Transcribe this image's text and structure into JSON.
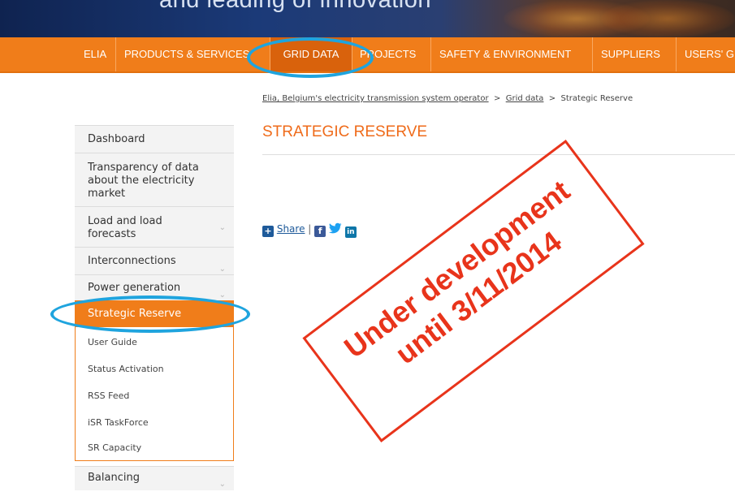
{
  "header": {
    "tagline": "and leading of innovation"
  },
  "nav": {
    "items": [
      {
        "label": "ELIA"
      },
      {
        "label": "PRODUCTS & SERVICES"
      },
      {
        "label": "GRID DATA"
      },
      {
        "label": "PROJECTS"
      },
      {
        "label": "SAFETY & ENVIRONMENT"
      },
      {
        "label": "SUPPLIERS"
      },
      {
        "label": "USERS' G"
      }
    ]
  },
  "breadcrumb": {
    "home": "Elia, Belgium's electricity transmission system operator",
    "sep1": ">",
    "grid": "Grid data",
    "sep2": ">",
    "current": "Strategic Reserve"
  },
  "page": {
    "title": "STRATEGIC RESERVE"
  },
  "share": {
    "label": "Share",
    "divider": "|",
    "facebook": "f",
    "linkedin": "in"
  },
  "sidebar": {
    "items": [
      {
        "label": "Dashboard"
      },
      {
        "label": "Transparency of data about the electricity market"
      },
      {
        "label": "Load and load forecasts"
      },
      {
        "label": "Interconnections"
      },
      {
        "label": "Power generation"
      },
      {
        "label": "Strategic Reserve"
      },
      {
        "label": "Balancing"
      }
    ],
    "subitems": [
      {
        "label": "User Guide"
      },
      {
        "label": "Status Activation"
      },
      {
        "label": "RSS Feed"
      },
      {
        "label": "iSR TaskForce"
      },
      {
        "label": "SR Capacity"
      }
    ]
  },
  "stamp": {
    "line1": "Under development",
    "line2": "until 3/11/2014"
  },
  "colors": {
    "nav_orange": "#f07d1a",
    "title_orange": "#ef6b1a",
    "stamp_red": "#e8341b",
    "highlight_blue": "#1fa4de"
  }
}
